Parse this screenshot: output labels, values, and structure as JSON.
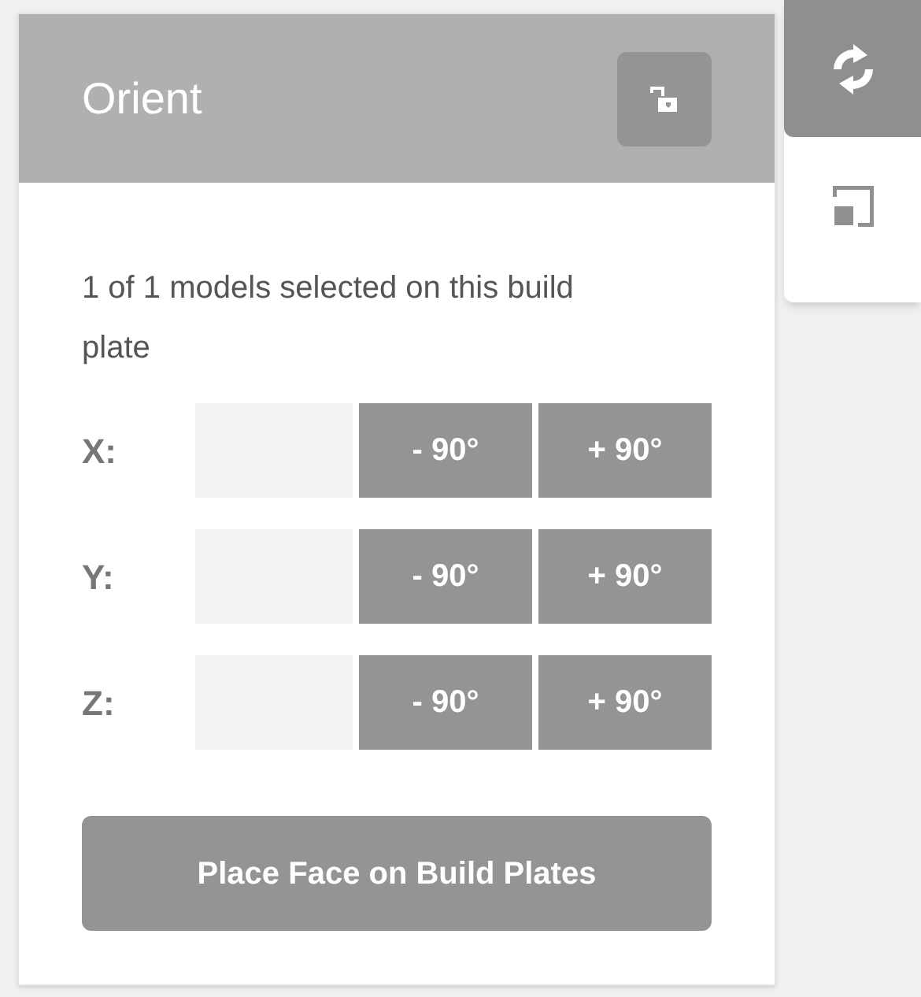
{
  "panel": {
    "title": "Orient",
    "lock": {
      "locked": false
    }
  },
  "info": "1 of 1 models selected on this build plate",
  "axes": [
    {
      "label": "X:",
      "buttons": [
        "- 90°",
        "+ 90°"
      ]
    },
    {
      "label": "Y:",
      "buttons": [
        "- 90°",
        "+ 90°"
      ]
    },
    {
      "label": "Z:",
      "buttons": [
        "- 90°",
        "+ 90°"
      ]
    }
  ],
  "action": "Place Face on Build Plates",
  "tools": [
    {
      "kind": "rotate",
      "selected": true
    },
    {
      "kind": "scale",
      "selected": false
    }
  ]
}
